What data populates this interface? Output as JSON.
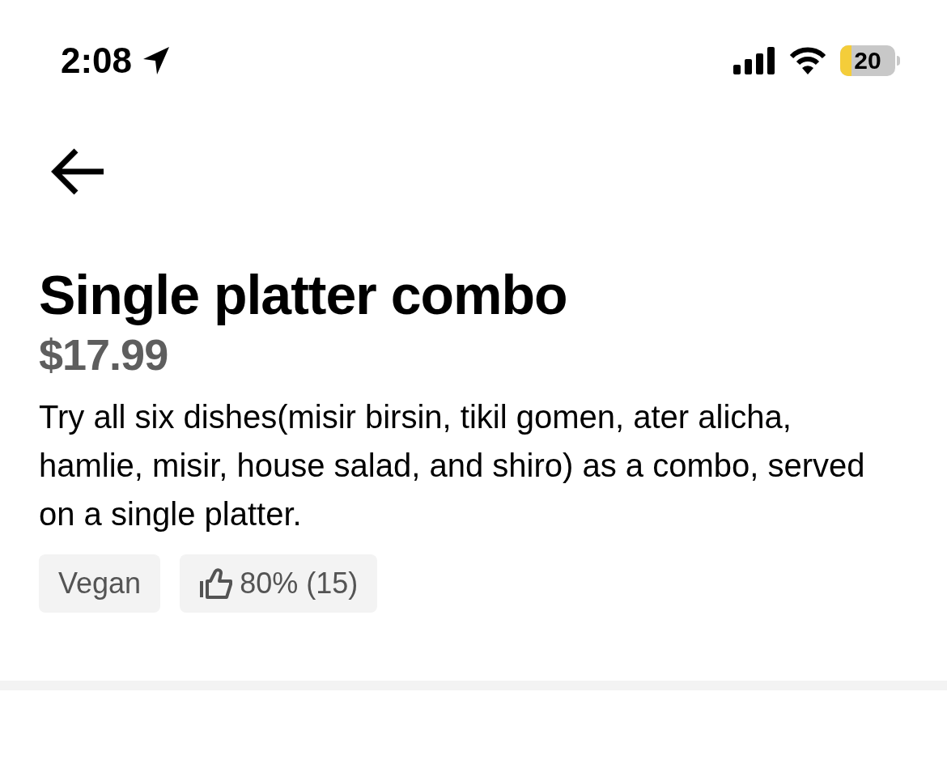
{
  "status_bar": {
    "time": "2:08",
    "battery": "20"
  },
  "item": {
    "title": "Single platter combo",
    "price": "$17.99",
    "description": "Try all six dishes(misir birsin, tikil gomen, ater alicha, hamlie, misir, house salad, and shiro) as a combo, served on a single platter.",
    "tags": [
      {
        "kind": "label",
        "text": "Vegan"
      },
      {
        "kind": "rating",
        "text": "80% (15)"
      }
    ]
  }
}
